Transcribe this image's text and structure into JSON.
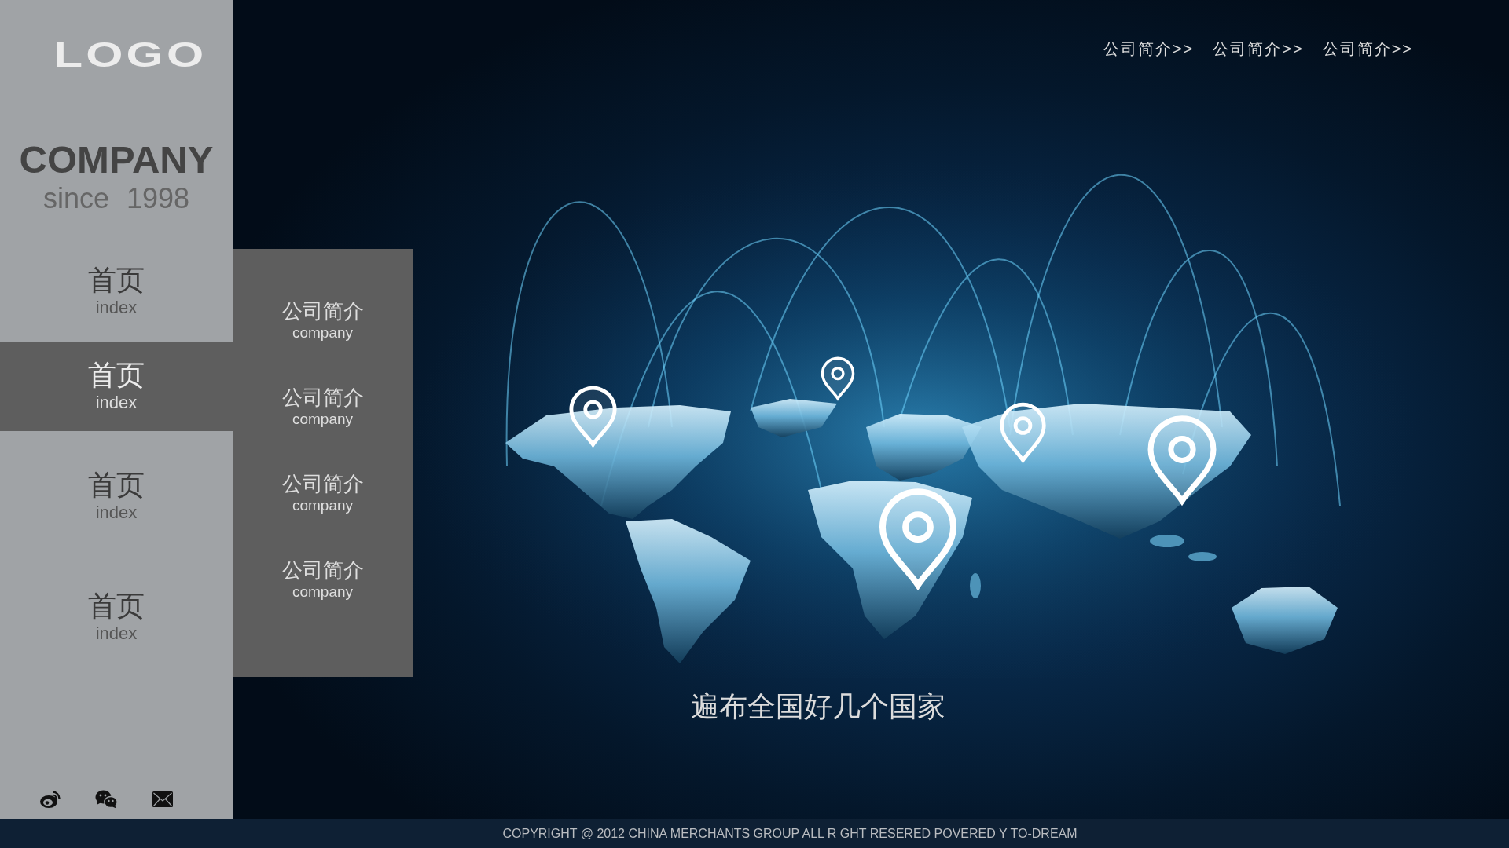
{
  "sidebar": {
    "logo": "LOGO",
    "company": "COMPANY",
    "since": "since 1998",
    "nav": [
      {
        "title": "首页",
        "subtitle": "index",
        "selected": false
      },
      {
        "title": "首页",
        "subtitle": "index",
        "selected": true
      },
      {
        "title": "首页",
        "subtitle": "index",
        "selected": false
      },
      {
        "title": "首页",
        "subtitle": "index",
        "selected": false
      }
    ]
  },
  "submenu": [
    {
      "title": "公司简介",
      "subtitle": "company"
    },
    {
      "title": "公司简介",
      "subtitle": "company"
    },
    {
      "title": "公司简介",
      "subtitle": "company"
    },
    {
      "title": "公司简介",
      "subtitle": "company"
    }
  ],
  "top_nav": [
    {
      "label": "公司简介>>"
    },
    {
      "label": "公司简介>>"
    },
    {
      "label": "公司简介>>"
    }
  ],
  "caption": "遍布全国好几个国家",
  "footer": {
    "copyright": "COPYRIGHT @ 2012 CHINA MERCHANTS GROUP ALL R GHT RESERED POVERED Y TO-DREAM"
  }
}
